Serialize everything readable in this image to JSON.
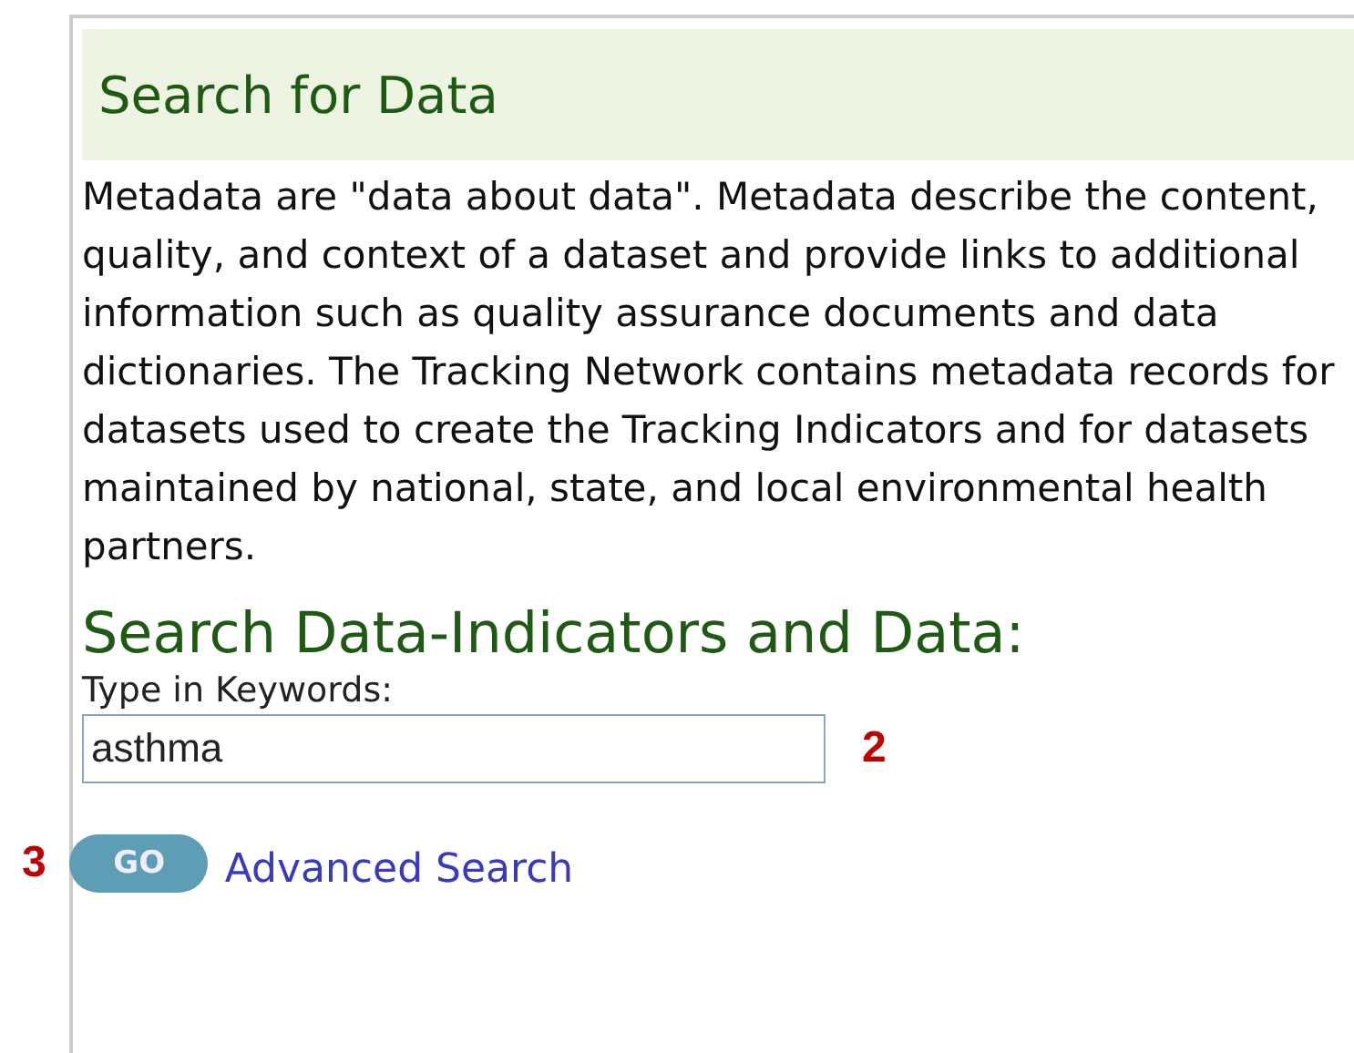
{
  "header": {
    "title": "Search for Data"
  },
  "description": "Metadata are \"data about data\". Metadata describe the content, quality, and context of a dataset and provide links to additional information such as quality assurance documents and data dictionaries. The Tracking Network contains metadata records for datasets used to create the Tracking Indicators and for datasets maintained by national, state, and local environmental health partners.",
  "search": {
    "heading": "Search Data-Indicators and Data:",
    "label": "Type in Keywords:",
    "value": "asthma",
    "button": "GO",
    "link": "Advanced Search"
  },
  "callouts": [
    "2",
    "3"
  ]
}
